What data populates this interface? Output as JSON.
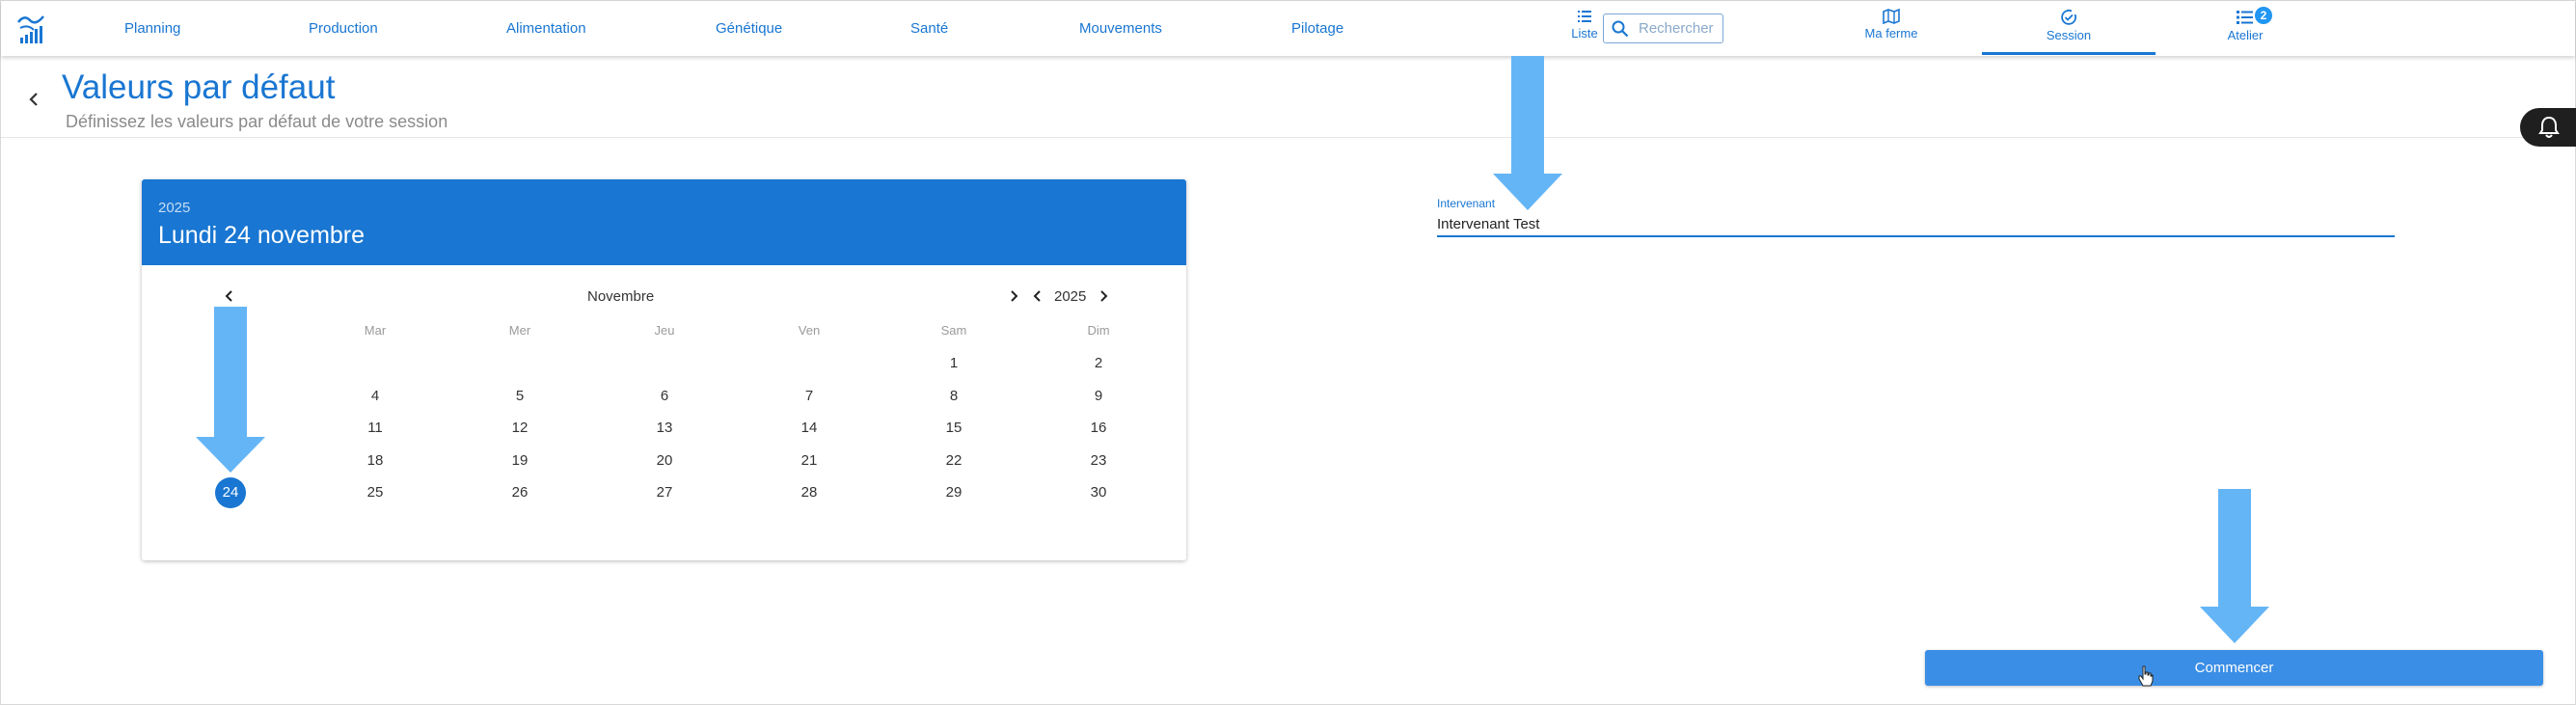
{
  "nav": {
    "items": [
      "Planning",
      "Production",
      "Alimentation",
      "Génétique",
      "Santé",
      "Mouvements",
      "Pilotage"
    ]
  },
  "toolbar": {
    "liste_label": "Liste",
    "search_placeholder": "Rechercher",
    "ferme_label": "Ma ferme",
    "session_label": "Session",
    "atelier_label": "Atelier",
    "atelier_badge": "2"
  },
  "page": {
    "title": "Valeurs par défaut",
    "subtitle": "Définissez les valeurs par défaut de votre session"
  },
  "calendar": {
    "year": "2025",
    "selected_date": "Lundi 24 novembre",
    "month_label": "Novembre",
    "year_label": "2025",
    "weekdays": [
      "Mar",
      "Mer",
      "Jeu",
      "Ven",
      "Sam",
      "Dim"
    ],
    "days": {
      "d1": "1",
      "d2": "2",
      "d4": "4",
      "d5": "5",
      "d6": "6",
      "d7": "7",
      "d8": "8",
      "d9": "9",
      "d11": "11",
      "d12": "12",
      "d13": "13",
      "d14": "14",
      "d15": "15",
      "d16": "16",
      "d18": "18",
      "d19": "19",
      "d20": "20",
      "d21": "21",
      "d22": "22",
      "d23": "23",
      "d24": "24",
      "d25": "25",
      "d26": "26",
      "d27": "27",
      "d28": "28",
      "d29": "29",
      "d30": "30"
    }
  },
  "form": {
    "intervenant_label": "Intervenant",
    "intervenant_value": "Intervenant Test",
    "start_button": "Commencer"
  },
  "colors": {
    "primary": "#1976d2",
    "arrow": "#64b5f6",
    "button": "#3a8ee6"
  }
}
